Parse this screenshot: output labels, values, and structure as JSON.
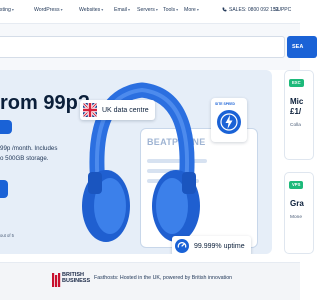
{
  "nav": {
    "items": [
      {
        "label": "osting"
      },
      {
        "label": "WordPress"
      },
      {
        "label": "Websites"
      },
      {
        "label": "Email"
      },
      {
        "label": "Servers"
      },
      {
        "label": "Tools"
      },
      {
        "label": "More"
      }
    ],
    "sales": "SALES: 0800 092 151",
    "support": "SUPPC"
  },
  "search": {
    "button_label": "SEA"
  },
  "hero": {
    "title": "rom 99p?",
    "desc_line1": "99p /month. Includes",
    "desc_line2": "o 500GB storage.",
    "small_text": "out of 5",
    "screen_logo": "BEATPHONE",
    "badge_uk": "UK data centre",
    "badge_uptime": "99.999% uptime",
    "speed_label": "SITE SPEED"
  },
  "right_cards": [
    {
      "tag": "EXC",
      "title": "Mic",
      "price": "£1/",
      "sub": "Colla"
    },
    {
      "tag": "VPS",
      "title": "Gra",
      "sub": "Mone"
    }
  ],
  "footer": {
    "bb_line1": "BRITISH",
    "bb_line2": "BUSINESS",
    "text": "Fasthosts: Hosted in the UK, powered by British innovation"
  },
  "colors": {
    "brand_blue": "#1a62d6",
    "navy": "#0b1f3a",
    "green_tag": "#1db97a",
    "hero_bg": "#e6eef8"
  }
}
